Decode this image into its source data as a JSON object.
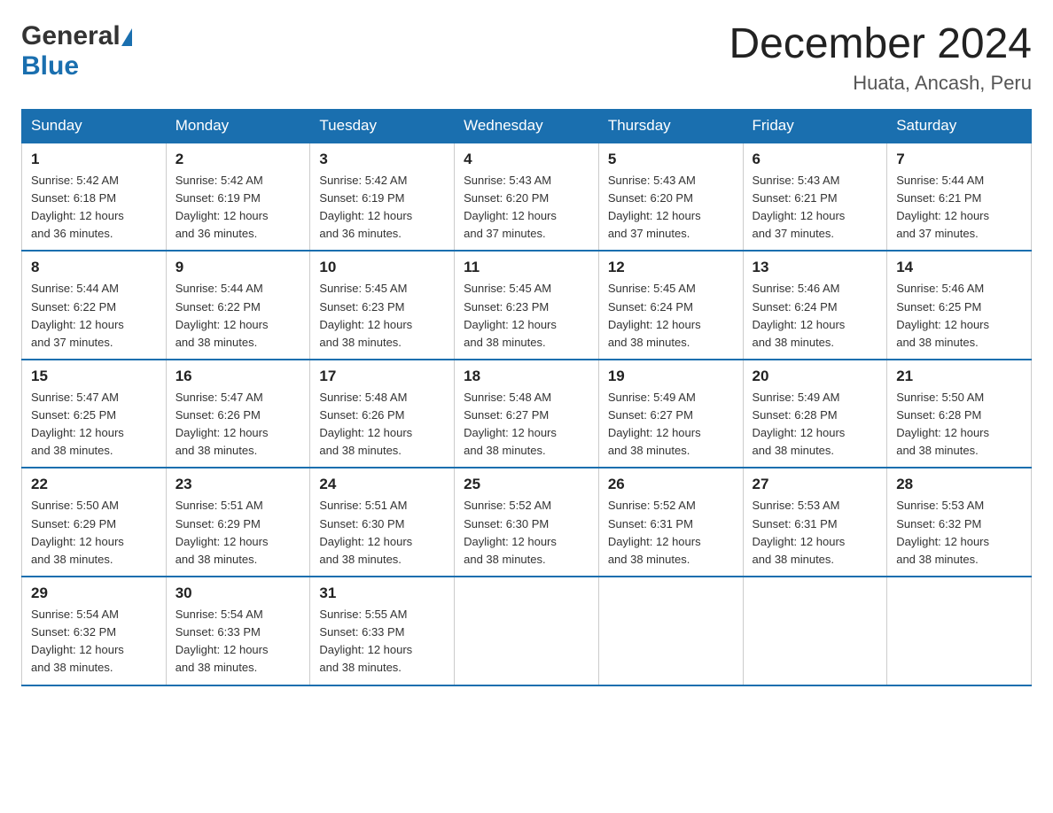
{
  "header": {
    "logo_general": "General",
    "logo_blue": "Blue",
    "month_title": "December 2024",
    "location": "Huata, Ancash, Peru"
  },
  "days_of_week": [
    "Sunday",
    "Monday",
    "Tuesday",
    "Wednesday",
    "Thursday",
    "Friday",
    "Saturday"
  ],
  "weeks": [
    [
      {
        "day": "1",
        "sunrise": "5:42 AM",
        "sunset": "6:18 PM",
        "daylight": "12 hours and 36 minutes."
      },
      {
        "day": "2",
        "sunrise": "5:42 AM",
        "sunset": "6:19 PM",
        "daylight": "12 hours and 36 minutes."
      },
      {
        "day": "3",
        "sunrise": "5:42 AM",
        "sunset": "6:19 PM",
        "daylight": "12 hours and 36 minutes."
      },
      {
        "day": "4",
        "sunrise": "5:43 AM",
        "sunset": "6:20 PM",
        "daylight": "12 hours and 37 minutes."
      },
      {
        "day": "5",
        "sunrise": "5:43 AM",
        "sunset": "6:20 PM",
        "daylight": "12 hours and 37 minutes."
      },
      {
        "day": "6",
        "sunrise": "5:43 AM",
        "sunset": "6:21 PM",
        "daylight": "12 hours and 37 minutes."
      },
      {
        "day": "7",
        "sunrise": "5:44 AM",
        "sunset": "6:21 PM",
        "daylight": "12 hours and 37 minutes."
      }
    ],
    [
      {
        "day": "8",
        "sunrise": "5:44 AM",
        "sunset": "6:22 PM",
        "daylight": "12 hours and 37 minutes."
      },
      {
        "day": "9",
        "sunrise": "5:44 AM",
        "sunset": "6:22 PM",
        "daylight": "12 hours and 38 minutes."
      },
      {
        "day": "10",
        "sunrise": "5:45 AM",
        "sunset": "6:23 PM",
        "daylight": "12 hours and 38 minutes."
      },
      {
        "day": "11",
        "sunrise": "5:45 AM",
        "sunset": "6:23 PM",
        "daylight": "12 hours and 38 minutes."
      },
      {
        "day": "12",
        "sunrise": "5:45 AM",
        "sunset": "6:24 PM",
        "daylight": "12 hours and 38 minutes."
      },
      {
        "day": "13",
        "sunrise": "5:46 AM",
        "sunset": "6:24 PM",
        "daylight": "12 hours and 38 minutes."
      },
      {
        "day": "14",
        "sunrise": "5:46 AM",
        "sunset": "6:25 PM",
        "daylight": "12 hours and 38 minutes."
      }
    ],
    [
      {
        "day": "15",
        "sunrise": "5:47 AM",
        "sunset": "6:25 PM",
        "daylight": "12 hours and 38 minutes."
      },
      {
        "day": "16",
        "sunrise": "5:47 AM",
        "sunset": "6:26 PM",
        "daylight": "12 hours and 38 minutes."
      },
      {
        "day": "17",
        "sunrise": "5:48 AM",
        "sunset": "6:26 PM",
        "daylight": "12 hours and 38 minutes."
      },
      {
        "day": "18",
        "sunrise": "5:48 AM",
        "sunset": "6:27 PM",
        "daylight": "12 hours and 38 minutes."
      },
      {
        "day": "19",
        "sunrise": "5:49 AM",
        "sunset": "6:27 PM",
        "daylight": "12 hours and 38 minutes."
      },
      {
        "day": "20",
        "sunrise": "5:49 AM",
        "sunset": "6:28 PM",
        "daylight": "12 hours and 38 minutes."
      },
      {
        "day": "21",
        "sunrise": "5:50 AM",
        "sunset": "6:28 PM",
        "daylight": "12 hours and 38 minutes."
      }
    ],
    [
      {
        "day": "22",
        "sunrise": "5:50 AM",
        "sunset": "6:29 PM",
        "daylight": "12 hours and 38 minutes."
      },
      {
        "day": "23",
        "sunrise": "5:51 AM",
        "sunset": "6:29 PM",
        "daylight": "12 hours and 38 minutes."
      },
      {
        "day": "24",
        "sunrise": "5:51 AM",
        "sunset": "6:30 PM",
        "daylight": "12 hours and 38 minutes."
      },
      {
        "day": "25",
        "sunrise": "5:52 AM",
        "sunset": "6:30 PM",
        "daylight": "12 hours and 38 minutes."
      },
      {
        "day": "26",
        "sunrise": "5:52 AM",
        "sunset": "6:31 PM",
        "daylight": "12 hours and 38 minutes."
      },
      {
        "day": "27",
        "sunrise": "5:53 AM",
        "sunset": "6:31 PM",
        "daylight": "12 hours and 38 minutes."
      },
      {
        "day": "28",
        "sunrise": "5:53 AM",
        "sunset": "6:32 PM",
        "daylight": "12 hours and 38 minutes."
      }
    ],
    [
      {
        "day": "29",
        "sunrise": "5:54 AM",
        "sunset": "6:32 PM",
        "daylight": "12 hours and 38 minutes."
      },
      {
        "day": "30",
        "sunrise": "5:54 AM",
        "sunset": "6:33 PM",
        "daylight": "12 hours and 38 minutes."
      },
      {
        "day": "31",
        "sunrise": "5:55 AM",
        "sunset": "6:33 PM",
        "daylight": "12 hours and 38 minutes."
      },
      null,
      null,
      null,
      null
    ]
  ],
  "labels": {
    "sunrise": "Sunrise: ",
    "sunset": "Sunset: ",
    "daylight": "Daylight: "
  }
}
